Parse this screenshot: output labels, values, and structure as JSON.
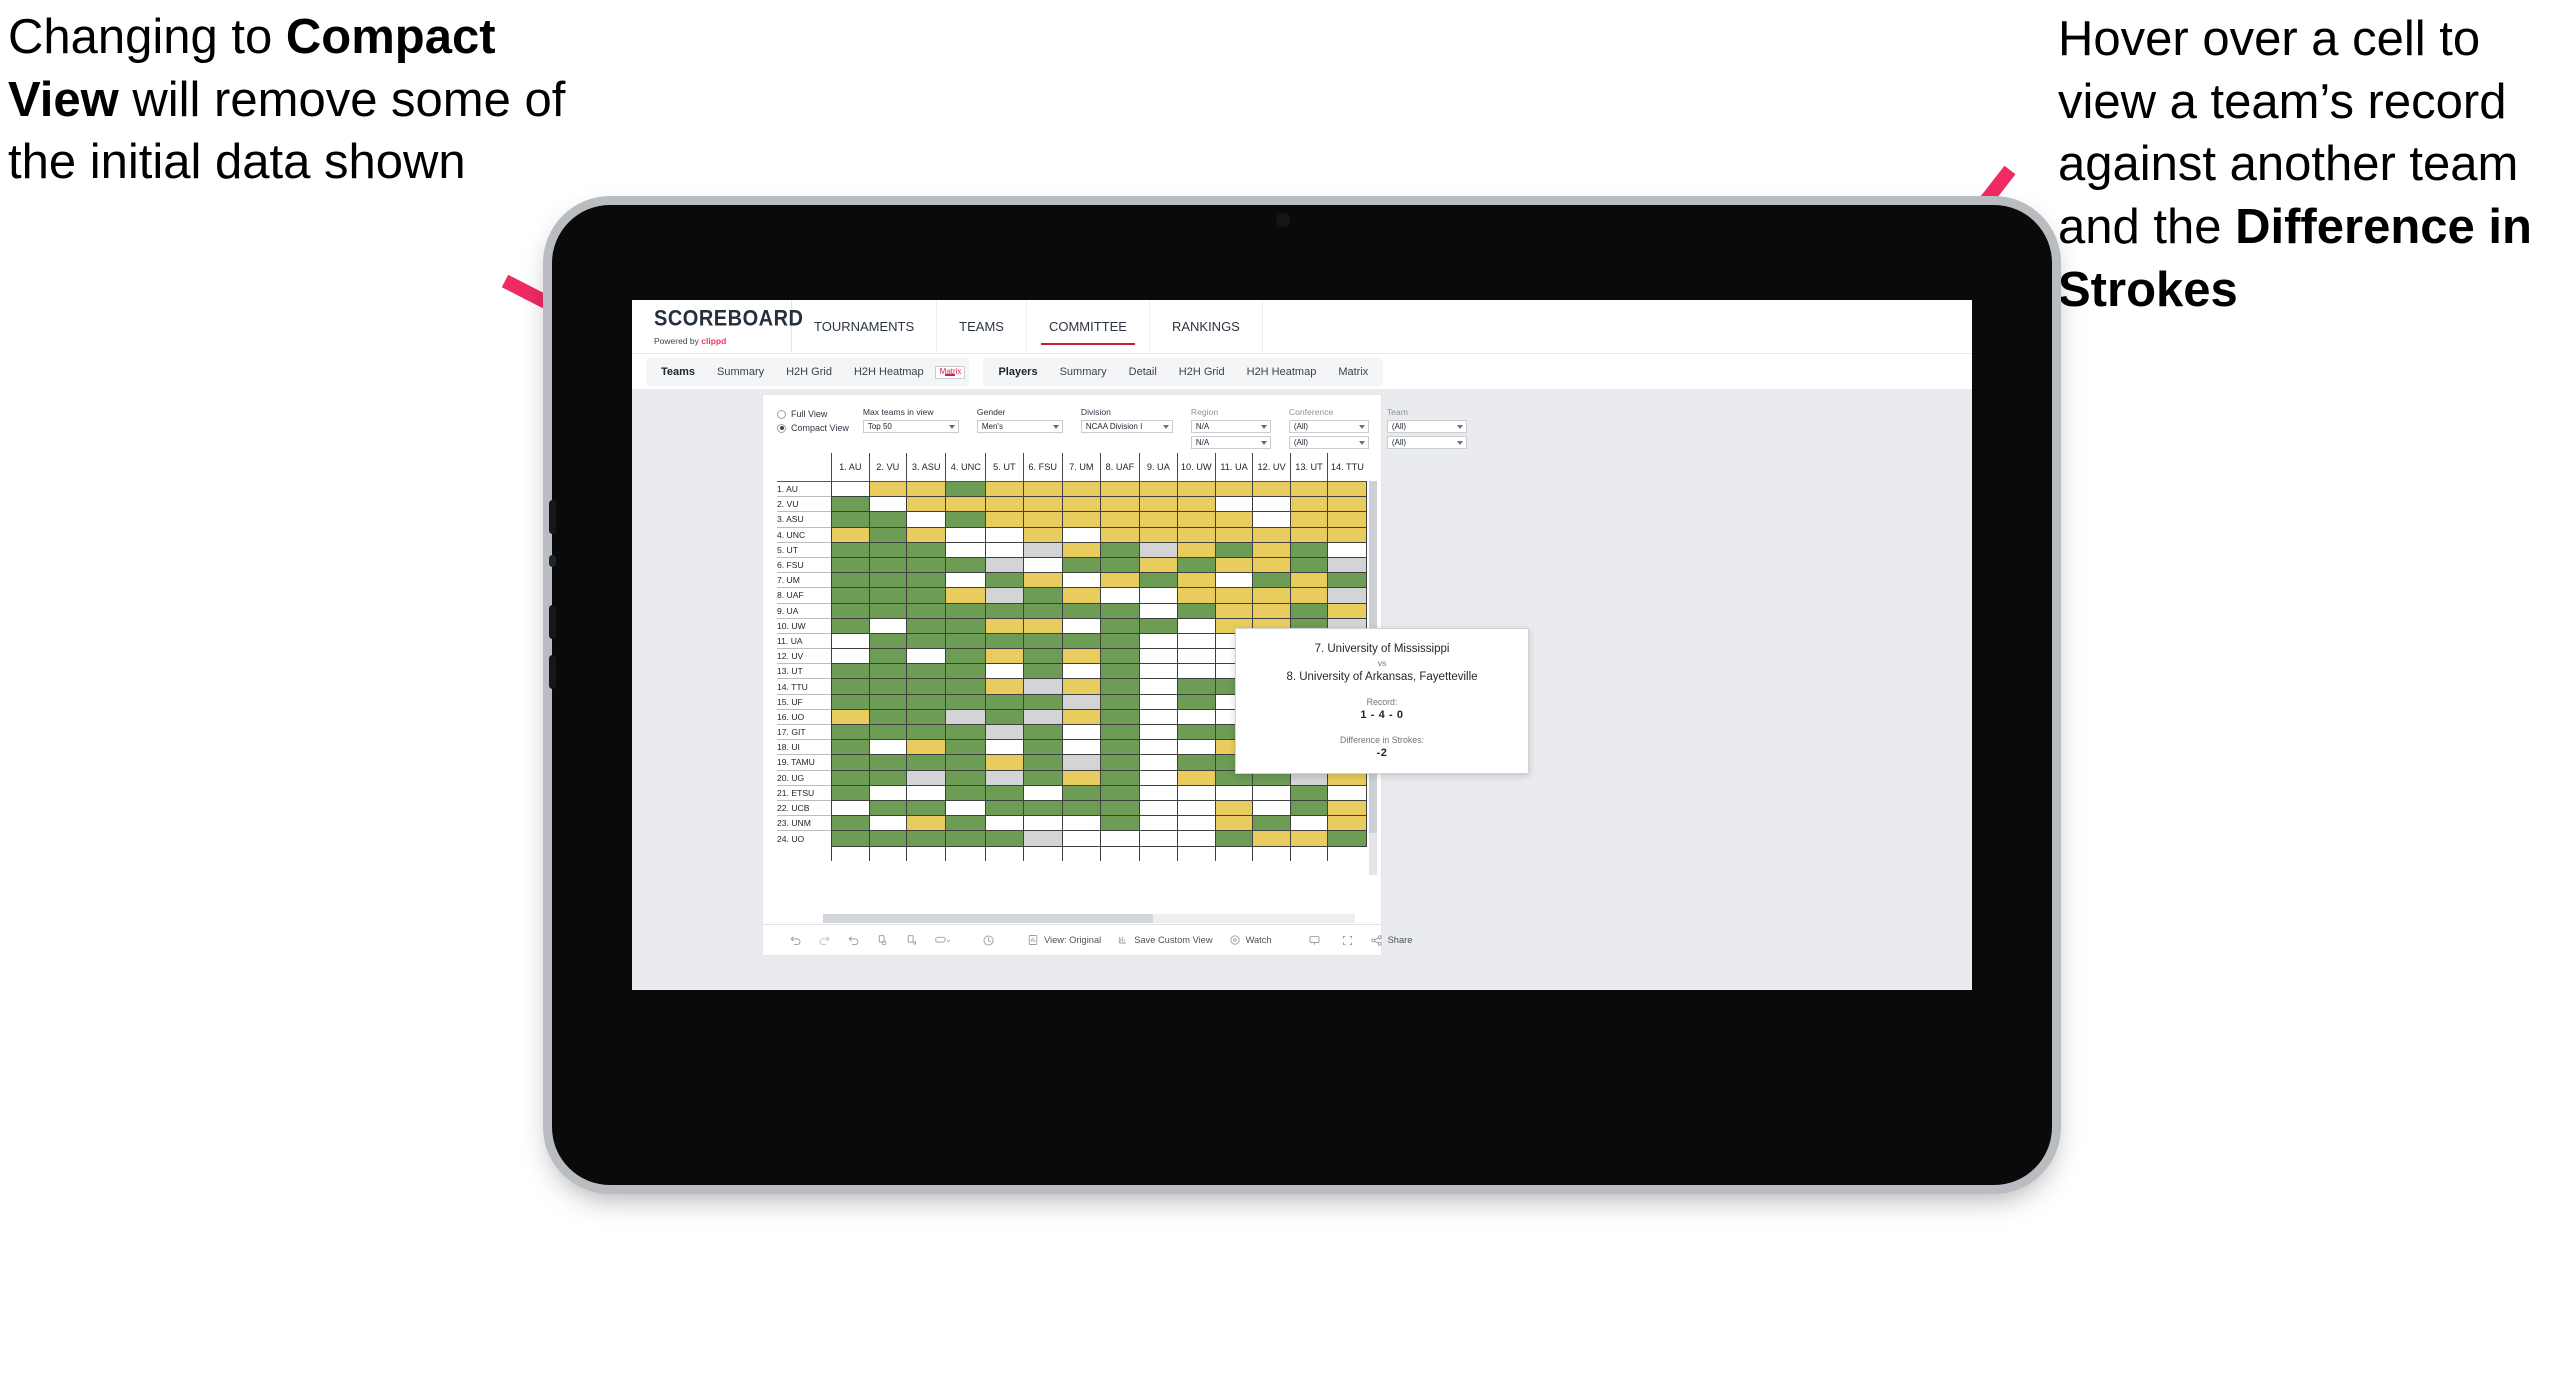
{
  "annotations": {
    "left_html": "Changing to <b>Compact View</b> will remove some of the initial data shown",
    "right_html": "Hover over a cell to view a team&rsquo;s record against another team and the <b>Difference in Strokes</b>",
    "arrow_color": "#ef2b63"
  },
  "app": {
    "brand": {
      "name": "SCOREBOARD",
      "powered_prefix": "Powered by ",
      "powered_brand": "clippd"
    },
    "top_nav": [
      {
        "label": "TOURNAMENTS",
        "active": false
      },
      {
        "label": "TEAMS",
        "active": false
      },
      {
        "label": "COMMITTEE",
        "active": true
      },
      {
        "label": "RANKINGS",
        "active": false
      }
    ],
    "sub_nav": {
      "teams_group": [
        "Teams",
        "Summary",
        "H2H Grid",
        "H2H Heatmap",
        "Matrix"
      ],
      "teams_selected": "Matrix",
      "players_group": [
        "Players",
        "Summary",
        "Detail",
        "H2H Grid",
        "H2H Heatmap",
        "Matrix"
      ],
      "players_selected": ""
    },
    "filters": {
      "view_options": [
        {
          "label": "Full View",
          "selected": false
        },
        {
          "label": "Compact View",
          "selected": true
        }
      ],
      "dropdowns": [
        {
          "label": "Max teams in view",
          "value": "Top 50",
          "muted_label": false
        },
        {
          "label": "Gender",
          "value": "Men's",
          "muted_label": false
        },
        {
          "label": "Division",
          "value": "NCAA Division I",
          "muted_label": false
        },
        {
          "label": "Region",
          "value": "N/A",
          "value2": "N/A",
          "muted_label": true
        },
        {
          "label": "Conference",
          "value": "(All)",
          "value2": "(All)",
          "muted_label": true
        },
        {
          "label": "Team",
          "value": "(All)",
          "value2": "(All)",
          "muted_label": true
        }
      ]
    },
    "toolbar": {
      "view_label": "View: Original",
      "save_label": "Save Custom View",
      "watch_label": "Watch",
      "share_label": "Share"
    },
    "tooltip": {
      "team_a": "7. University of Mississippi",
      "vs": "vs",
      "team_b": "8. University of Arkansas, Fayetteville",
      "record_label": "Record:",
      "record_value": "1 - 4 - 0",
      "strokes_label": "Difference in Strokes:",
      "strokes_value": "-2"
    }
  },
  "chart_data": {
    "type": "heatmap",
    "title": "",
    "legend": {
      "green": "win",
      "yellow": "loss",
      "grey": "tie/no data",
      "white": "none"
    },
    "colors": {
      "green": "#6d9c55",
      "yellow": "#e8cc5e",
      "grey": "#d2d4d6",
      "white": "#ffffff"
    },
    "columns": [
      "1. AU",
      "2. VU",
      "3. ASU",
      "4. UNC",
      "5. UT",
      "6. FSU",
      "7. UM",
      "8. UAF",
      "9. UA",
      "10. UW",
      "11. UA",
      "12. UV",
      "13. UT",
      "14. TTU"
    ],
    "rows": [
      "1. AU",
      "2. VU",
      "3. ASU",
      "4. UNC",
      "5. UT",
      "6. FSU",
      "7. UM",
      "8. UAF",
      "9. UA",
      "10. UW",
      "11. UA",
      "12. UV",
      "13. UT",
      "14. TTU",
      "15. UF",
      "16. UO",
      "17. GIT",
      "18. UI",
      "19. TAMU",
      "20. UG",
      "21. ETSU",
      "22. UCB",
      "23. UNM",
      "24. UO"
    ],
    "cells": [
      [
        "w",
        "y",
        "y",
        "g",
        "y",
        "y",
        "y",
        "y",
        "y",
        "y",
        "y",
        "y",
        "y",
        "y"
      ],
      [
        "g",
        "w",
        "y",
        "y",
        "y",
        "y",
        "y",
        "y",
        "y",
        "y",
        "w",
        "w",
        "y",
        "y"
      ],
      [
        "g",
        "g",
        "w",
        "g",
        "y",
        "y",
        "y",
        "y",
        "y",
        "y",
        "y",
        "w",
        "y",
        "y"
      ],
      [
        "y",
        "g",
        "y",
        "w",
        "w",
        "y",
        "w",
        "y",
        "y",
        "y",
        "y",
        "y",
        "y",
        "y"
      ],
      [
        "g",
        "g",
        "g",
        "w",
        "w",
        "s",
        "y",
        "g",
        "s",
        "y",
        "g",
        "y",
        "g",
        "w"
      ],
      [
        "g",
        "g",
        "g",
        "g",
        "s",
        "w",
        "g",
        "g",
        "y",
        "g",
        "y",
        "y",
        "g",
        "s"
      ],
      [
        "g",
        "g",
        "g",
        "w",
        "g",
        "y",
        "w",
        "y",
        "g",
        "y",
        "w",
        "g",
        "y",
        "g"
      ],
      [
        "g",
        "g",
        "g",
        "y",
        "s",
        "g",
        "y",
        "w",
        "w",
        "y",
        "y",
        "y",
        "y",
        "s"
      ],
      [
        "g",
        "g",
        "g",
        "g",
        "g",
        "g",
        "g",
        "g",
        "w",
        "g",
        "y",
        "y",
        "g",
        "y"
      ],
      [
        "g",
        "w",
        "g",
        "g",
        "y",
        "y",
        "w",
        "g",
        "g",
        "w",
        "y",
        "y",
        "g",
        "s"
      ],
      [
        "w",
        "g",
        "g",
        "g",
        "g",
        "g",
        "g",
        "g",
        "w",
        "w",
        "w",
        "y",
        "y",
        "y"
      ],
      [
        "w",
        "g",
        "w",
        "g",
        "y",
        "g",
        "y",
        "g",
        "w",
        "w",
        "w",
        "w",
        "w",
        "w"
      ],
      [
        "g",
        "g",
        "g",
        "g",
        "w",
        "g",
        "w",
        "g",
        "w",
        "w",
        "w",
        "y",
        "y",
        "y"
      ],
      [
        "g",
        "g",
        "g",
        "g",
        "y",
        "s",
        "y",
        "g",
        "w",
        "g",
        "g",
        "g",
        "y",
        "w"
      ],
      [
        "g",
        "g",
        "g",
        "g",
        "g",
        "g",
        "s",
        "g",
        "w",
        "g",
        "w",
        "g",
        "y",
        "y"
      ],
      [
        "y",
        "g",
        "g",
        "s",
        "g",
        "s",
        "y",
        "g",
        "w",
        "w",
        "w",
        "w",
        "w",
        "s"
      ],
      [
        "g",
        "g",
        "g",
        "g",
        "s",
        "g",
        "w",
        "g",
        "w",
        "g",
        "g",
        "g",
        "y",
        "y"
      ],
      [
        "g",
        "w",
        "y",
        "g",
        "w",
        "g",
        "w",
        "g",
        "w",
        "w",
        "y",
        "w",
        "g",
        "y"
      ],
      [
        "g",
        "g",
        "g",
        "g",
        "y",
        "g",
        "s",
        "g",
        "w",
        "g",
        "g",
        "w",
        "y",
        "g"
      ],
      [
        "g",
        "g",
        "s",
        "g",
        "s",
        "g",
        "y",
        "g",
        "w",
        "y",
        "g",
        "g",
        "s",
        "y"
      ],
      [
        "g",
        "w",
        "w",
        "g",
        "g",
        "w",
        "g",
        "g",
        "w",
        "w",
        "w",
        "w",
        "g",
        "w"
      ],
      [
        "w",
        "g",
        "g",
        "w",
        "g",
        "g",
        "g",
        "g",
        "w",
        "w",
        "y",
        "w",
        "g",
        "y"
      ],
      [
        "g",
        "w",
        "y",
        "g",
        "w",
        "w",
        "w",
        "g",
        "w",
        "w",
        "y",
        "g",
        "w",
        "y"
      ],
      [
        "g",
        "g",
        "g",
        "g",
        "g",
        "s",
        "w",
        "w",
        "w",
        "w",
        "g",
        "y",
        "y",
        "g"
      ]
    ]
  }
}
